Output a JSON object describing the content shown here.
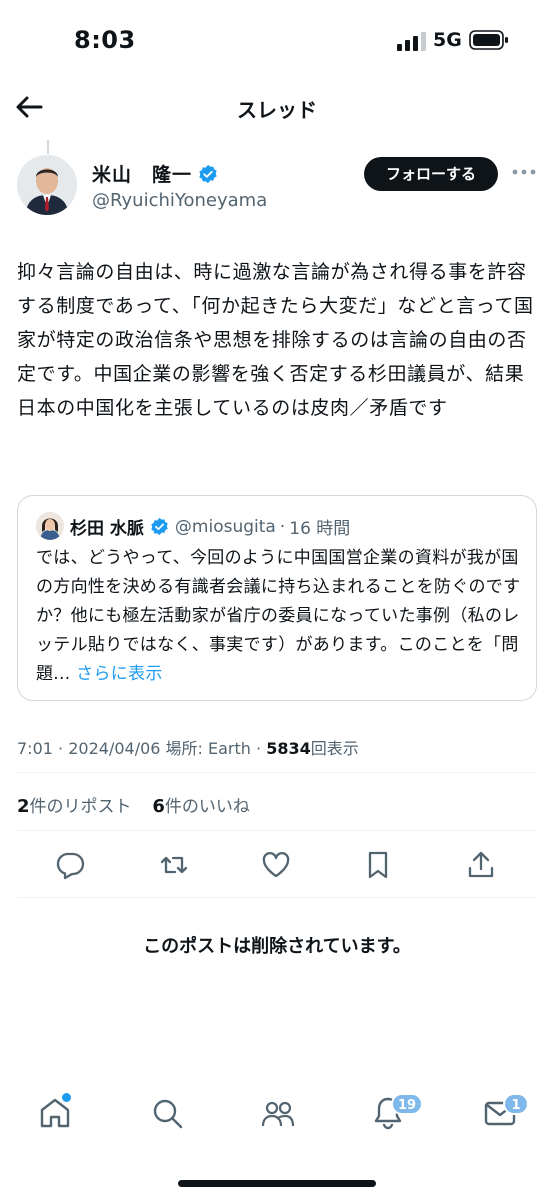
{
  "status_bar": {
    "time": "8:03",
    "network": "5G"
  },
  "header": {
    "title": "スレッド"
  },
  "author": {
    "name": "米山　隆一",
    "handle": "@RyuichiYoneyama",
    "follow_label": "フォローする"
  },
  "tweet": {
    "text": "抑々言論の自由は、時に過激な言論が為され得る事を許容する制度であって、「何か起きたら大変だ」などと言って国家が特定の政治信条や思想を排除するのは言論の自由の否定です。中国企業の影響を強く否定する杉田議員が、結果日本の中国化を主張しているのは皮肉／矛盾です"
  },
  "quote": {
    "name": "杉田 水脈",
    "handle": "@miosugita",
    "separator": "·",
    "time": "16 時間",
    "text": "では、どうやって、今回のように中国国営企業の資料が我が国の方向性を決める有識者会議に持ち込まれることを防ぐのですか？他にも極左活動家が省庁の委員になっていた事例（私のレッテル貼りではなく、事実です）があります。このことを「問題...",
    "show_more": "さらに表示"
  },
  "meta": {
    "time": "7:01",
    "sep1": "·",
    "date": "2024/04/06",
    "location": "場所: Earth",
    "sep2": "·",
    "views": "5834",
    "views_label": "回表示"
  },
  "stats": {
    "reposts": "2",
    "reposts_label": "件のリポスト",
    "likes": "6",
    "likes_label": "件のいいね"
  },
  "deleted_notice": "このポストは削除されています。",
  "tabbar": {
    "notifications_badge": "19",
    "messages_badge": "1"
  },
  "colors": {
    "accent": "#1d9bf0",
    "text": "#0f1419",
    "muted": "#536471",
    "badge": "#7fb8ea"
  }
}
